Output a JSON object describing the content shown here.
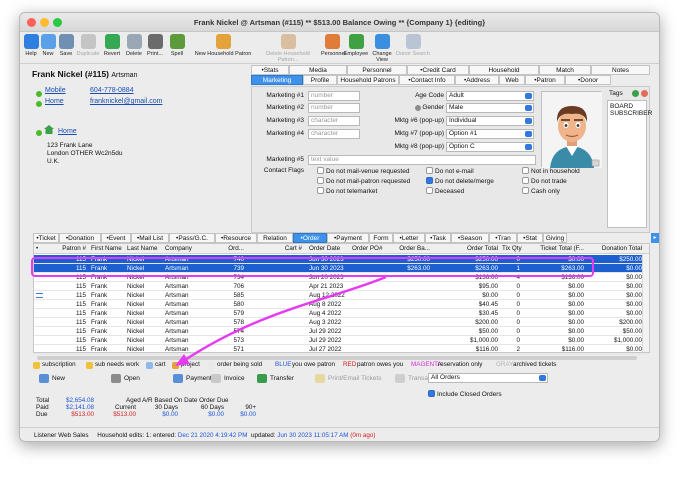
{
  "window": {
    "title": "Frank Nickel @ Artsman (#115) ** $513.00 Balance Owing ** {Company 1} {editing}"
  },
  "toolbar": [
    {
      "label": "Help",
      "icon": "help-icon",
      "color": "#2f7fe0",
      "enabled": true
    },
    {
      "label": "New",
      "icon": "new-icon",
      "color": "#5aa0e8",
      "enabled": true
    },
    {
      "label": "Save",
      "icon": "save-icon",
      "color": "#6f8fb3",
      "enabled": true
    },
    {
      "label": "Duplicate",
      "icon": "duplicate-icon",
      "color": "#c5c5c5",
      "enabled": false
    },
    {
      "label": "Revert",
      "icon": "revert-icon",
      "color": "#34a853",
      "enabled": true
    },
    {
      "label": "Delete",
      "icon": "delete-icon",
      "color": "#9aa7b4",
      "enabled": true
    },
    {
      "label": "Print...",
      "icon": "print-icon",
      "color": "#6b6b6b",
      "enabled": true
    },
    {
      "label": "Spell",
      "icon": "spell-icon",
      "color": "#5c9a3a",
      "enabled": true
    },
    {
      "label": "New Household Patron",
      "icon": "household-patron-icon",
      "color": "#e3a33a",
      "enabled": true
    },
    {
      "label": "Delete Household Patron...",
      "icon": "delete-household-icon",
      "color": "#d9bfa0",
      "enabled": false
    },
    {
      "label": "Personnel",
      "icon": "personnel-icon",
      "color": "#e07b39",
      "enabled": true
    },
    {
      "label": "Employee",
      "icon": "employee-icon",
      "color": "#3fa142",
      "enabled": true
    },
    {
      "label": "Change View",
      "icon": "change-view-icon",
      "color": "#3a8fe0",
      "enabled": true
    },
    {
      "label": "Donor Search",
      "icon": "donor-search-icon",
      "color": "#b9c4d4",
      "enabled": false
    }
  ],
  "patron": {
    "name": "Frank Nickel (#115)",
    "company": "Artsman",
    "mobile_label": "Mobile",
    "mobile": "604-778-0884",
    "home_label": "Home",
    "email": "franknickel@gmail.com",
    "address_label": "Home",
    "address_lines": [
      "123 Frank Lane",
      "London OTHER  Wc2n5du",
      "U.K."
    ]
  },
  "top_tabs_row1": [
    "•Stats",
    "Media",
    "Personnel",
    "•Credit Card",
    "Household",
    "Match",
    "Notes"
  ],
  "top_tabs_row2": [
    "Marketing",
    "Profile",
    "Household Patrons",
    "•Contact Info",
    "•Address",
    "Web",
    "•Patron",
    "•Donor"
  ],
  "marketing": {
    "fields": [
      {
        "label": "Marketing #1",
        "placeholder": "number"
      },
      {
        "label": "Marketing #2",
        "placeholder": "number"
      },
      {
        "label": "Marketing #3",
        "placeholder": "character"
      },
      {
        "label": "Marketing #4",
        "placeholder": "character"
      }
    ],
    "field5_label": "Marketing #5",
    "field5_placeholder": "text value",
    "selects": [
      {
        "label": "Age Code",
        "value": "Adult"
      },
      {
        "label": "Gender",
        "value": "Male"
      },
      {
        "label": "Mktg #6 (pop-up)",
        "value": "Individual"
      },
      {
        "label": "Mktg #7 (pop-up)",
        "value": "Option #1"
      },
      {
        "label": "Mktg #8 (pop-up)",
        "value": "Option C"
      }
    ],
    "contact_flags_label": "Contact Flags",
    "flags": [
      {
        "label": "Do not mail-venue requested",
        "checked": false
      },
      {
        "label": "Do not e-mail",
        "checked": false
      },
      {
        "label": "Not in household",
        "checked": false
      },
      {
        "label": "Do not mail-patron requested",
        "checked": false
      },
      {
        "label": "Do not delete/merge",
        "checked": true
      },
      {
        "label": "Do not trade",
        "checked": false
      },
      {
        "label": "Do not telemarket",
        "checked": false
      },
      {
        "label": "Deceased",
        "checked": false
      },
      {
        "label": "Cash only",
        "checked": false
      }
    ],
    "tags_label": "Tags",
    "tags": [
      "BOARD",
      "SUBSCRIBER"
    ]
  },
  "bottom_tabs": [
    "•Ticket",
    "•Donation",
    "•Event",
    "•Mail List",
    "•Pass/G.C.",
    "•Resource",
    "Relation",
    "•Order",
    "•Payment",
    "Form",
    "•Letter",
    "•Task",
    "•Season",
    "•Tran",
    "•Stat",
    "Giving"
  ],
  "grid": {
    "columns": [
      "•",
      "Patron #",
      "First Name",
      "Last Name",
      "Company",
      "Ord...",
      "Cart #",
      "Order Date",
      "Order PO#",
      "Order Ba...",
      "Order Total",
      "Tix Qty",
      "Ticket Total (F...",
      "Donation Total"
    ],
    "rows": [
      {
        "patron": "115",
        "first": "Frank",
        "last": "Nickel",
        "company": "Artsman",
        "ord": "740",
        "cart": "",
        "date": "Jun 30 2023",
        "po": "",
        "bal": "$250.00",
        "total": "$250.00",
        "qty": "0",
        "tix": "$0.00",
        "don": "$250.00",
        "sel": true,
        "flag": ""
      },
      {
        "patron": "115",
        "first": "Frank",
        "last": "Nickel",
        "company": "Artsman",
        "ord": "739",
        "cart": "",
        "date": "Jun 30 2023",
        "po": "",
        "bal": "$263.00",
        "total": "$263.00",
        "qty": "1",
        "tix": "$263.00",
        "don": "$0.00",
        "sel": true,
        "flag": ""
      },
      {
        "patron": "115",
        "first": "Frank",
        "last": "Nickel",
        "company": "Artsman",
        "ord": "734",
        "cart": "",
        "date": "Jun 20 2023",
        "po": "",
        "bal": "",
        "total": "$136.00",
        "qty": "4",
        "tix": "$136.00",
        "don": "$0.00",
        "sel": false,
        "flag": ""
      },
      {
        "patron": "115",
        "first": "Frank",
        "last": "Nickel",
        "company": "Artsman",
        "ord": "706",
        "cart": "",
        "date": "Apr 21 2023",
        "po": "",
        "bal": "",
        "total": "$95.00",
        "qty": "0",
        "tix": "$0.00",
        "don": "$0.00",
        "sel": false,
        "flag": ""
      },
      {
        "patron": "115",
        "first": "Frank",
        "last": "Nickel",
        "company": "Artsman",
        "ord": "585",
        "cart": "",
        "date": "Aug 12 2022",
        "po": "",
        "bal": "",
        "total": "$0.00",
        "qty": "0",
        "tix": "$0.00",
        "don": "$0.00",
        "sel": false,
        "flag": "arrows"
      },
      {
        "patron": "115",
        "first": "Frank",
        "last": "Nickel",
        "company": "Artsman",
        "ord": "580",
        "cart": "",
        "date": "Aug 8 2022",
        "po": "",
        "bal": "",
        "total": "$40.45",
        "qty": "0",
        "tix": "$0.00",
        "don": "$0.00",
        "sel": false,
        "flag": ""
      },
      {
        "patron": "115",
        "first": "Frank",
        "last": "Nickel",
        "company": "Artsman",
        "ord": "579",
        "cart": "",
        "date": "Aug 4 2022",
        "po": "",
        "bal": "",
        "total": "$30.45",
        "qty": "0",
        "tix": "$0.00",
        "don": "$0.00",
        "sel": false,
        "flag": ""
      },
      {
        "patron": "115",
        "first": "Frank",
        "last": "Nickel",
        "company": "Artsman",
        "ord": "578",
        "cart": "",
        "date": "Aug 3 2022",
        "po": "",
        "bal": "",
        "total": "$200.00",
        "qty": "0",
        "tix": "$0.00",
        "don": "$200.00",
        "sel": false,
        "flag": ""
      },
      {
        "patron": "115",
        "first": "Frank",
        "last": "Nickel",
        "company": "Artsman",
        "ord": "574",
        "cart": "",
        "date": "Jul 29 2022",
        "po": "",
        "bal": "",
        "total": "$50.00",
        "qty": "0",
        "tix": "$0.00",
        "don": "$50.00",
        "sel": false,
        "flag": ""
      },
      {
        "patron": "115",
        "first": "Frank",
        "last": "Nickel",
        "company": "Artsman",
        "ord": "573",
        "cart": "",
        "date": "Jul 29 2022",
        "po": "",
        "bal": "",
        "total": "$1,000.00",
        "qty": "0",
        "tix": "$0.00",
        "don": "$1,000.00",
        "sel": false,
        "flag": ""
      },
      {
        "patron": "115",
        "first": "Frank",
        "last": "Nickel",
        "company": "Artsman",
        "ord": "571",
        "cart": "",
        "date": "Jul 27 2022",
        "po": "",
        "bal": "",
        "total": "$116.00",
        "qty": "2",
        "tix": "$116.00",
        "don": "$0.00",
        "sel": false,
        "flag": ""
      }
    ]
  },
  "legend": [
    {
      "text": "subscription",
      "color": "#111111",
      "icon": "subscription-icon",
      "iconColor": "#f0c23a"
    },
    {
      "text": "sub needs work",
      "color": "#111111",
      "icon": "sub-needs-work-icon",
      "iconColor": "#f0c23a"
    },
    {
      "text": "cart",
      "color": "#111111",
      "icon": "cart-icon",
      "iconColor": "#8fb9e8"
    },
    {
      "text": "project",
      "color": "#111111",
      "icon": "project-icon",
      "iconColor": "#e9a23b"
    },
    {
      "text": "order being sold",
      "color": "#111111",
      "icon": "order-being-sold-icon",
      "iconColor": "#e9e9e9"
    },
    {
      "text": "BLUE",
      "color": "#1d56d8",
      "icon": "",
      "iconColor": ""
    },
    {
      "text": "you owe patron",
      "color": "#111111",
      "icon": "",
      "iconColor": ""
    },
    {
      "text": "RED",
      "color": "#d61e1e",
      "icon": "",
      "iconColor": ""
    },
    {
      "text": "patron owes you",
      "color": "#111111",
      "icon": "",
      "iconColor": ""
    },
    {
      "text": "MAGENTA",
      "color": "#d12ad6",
      "icon": "",
      "iconColor": ""
    },
    {
      "text": "reservation only",
      "color": "#111111",
      "icon": "",
      "iconColor": ""
    },
    {
      "text": "GRAY",
      "color": "#b5b5b5",
      "icon": "",
      "iconColor": ""
    },
    {
      "text": "archived tickets",
      "color": "#111111",
      "icon": "",
      "iconColor": ""
    }
  ],
  "actions": [
    {
      "label": "New",
      "icon": "new-order-icon",
      "color": "#5a8fd8",
      "enabled": true
    },
    {
      "label": "Open",
      "icon": "open-order-icon",
      "color": "#8c8c8c",
      "enabled": true
    },
    {
      "label": "Payment",
      "icon": "payment-icon",
      "color": "#5a8fd8",
      "enabled": true
    },
    {
      "label": "Invoice",
      "icon": "invoice-icon",
      "color": "#c9c9c9",
      "enabled": true
    },
    {
      "label": "Transfer",
      "icon": "transfer-icon",
      "color": "#3a9b4a",
      "enabled": true
    },
    {
      "label": "Print/Email Tickets",
      "icon": "print-tickets-icon",
      "color": "#e6d8a2",
      "enabled": false
    },
    {
      "label": "Transactions",
      "icon": "transactions-icon",
      "color": "#cfcfcf",
      "enabled": false
    }
  ],
  "order_filter": "All Orders",
  "include_closed_label": "Include Closed Orders",
  "include_closed_checked": true,
  "totals": {
    "labels": [
      "Total",
      "Paid",
      "Due"
    ],
    "values": [
      "$2,654.08",
      "$2,141.08",
      "$513.00"
    ],
    "aged_title": "Aged A/R Based On Date Order Due",
    "aged_cols": [
      "Current",
      "30 Days",
      "60 Days",
      "90+"
    ],
    "aged_vals": [
      "$513.00",
      "$0.00",
      "$0.00",
      "$0.00"
    ]
  },
  "status": {
    "source": "Listener Web Sales",
    "household_label": "Household edits:",
    "household_count": "1",
    "entered_label": "entered:",
    "entered": "Dec 21 2020 4:19:42 PM",
    "updated_label": "updated:",
    "updated": "Jun 30 2023 11:05:17 AM",
    "ago": "(0m ago)"
  },
  "colors": {
    "accent": "#3e92ec",
    "selection": "#1e5fcf",
    "highlight": "#e63bf2",
    "due": "#d61e1e",
    "paid": "#1d56d8"
  }
}
